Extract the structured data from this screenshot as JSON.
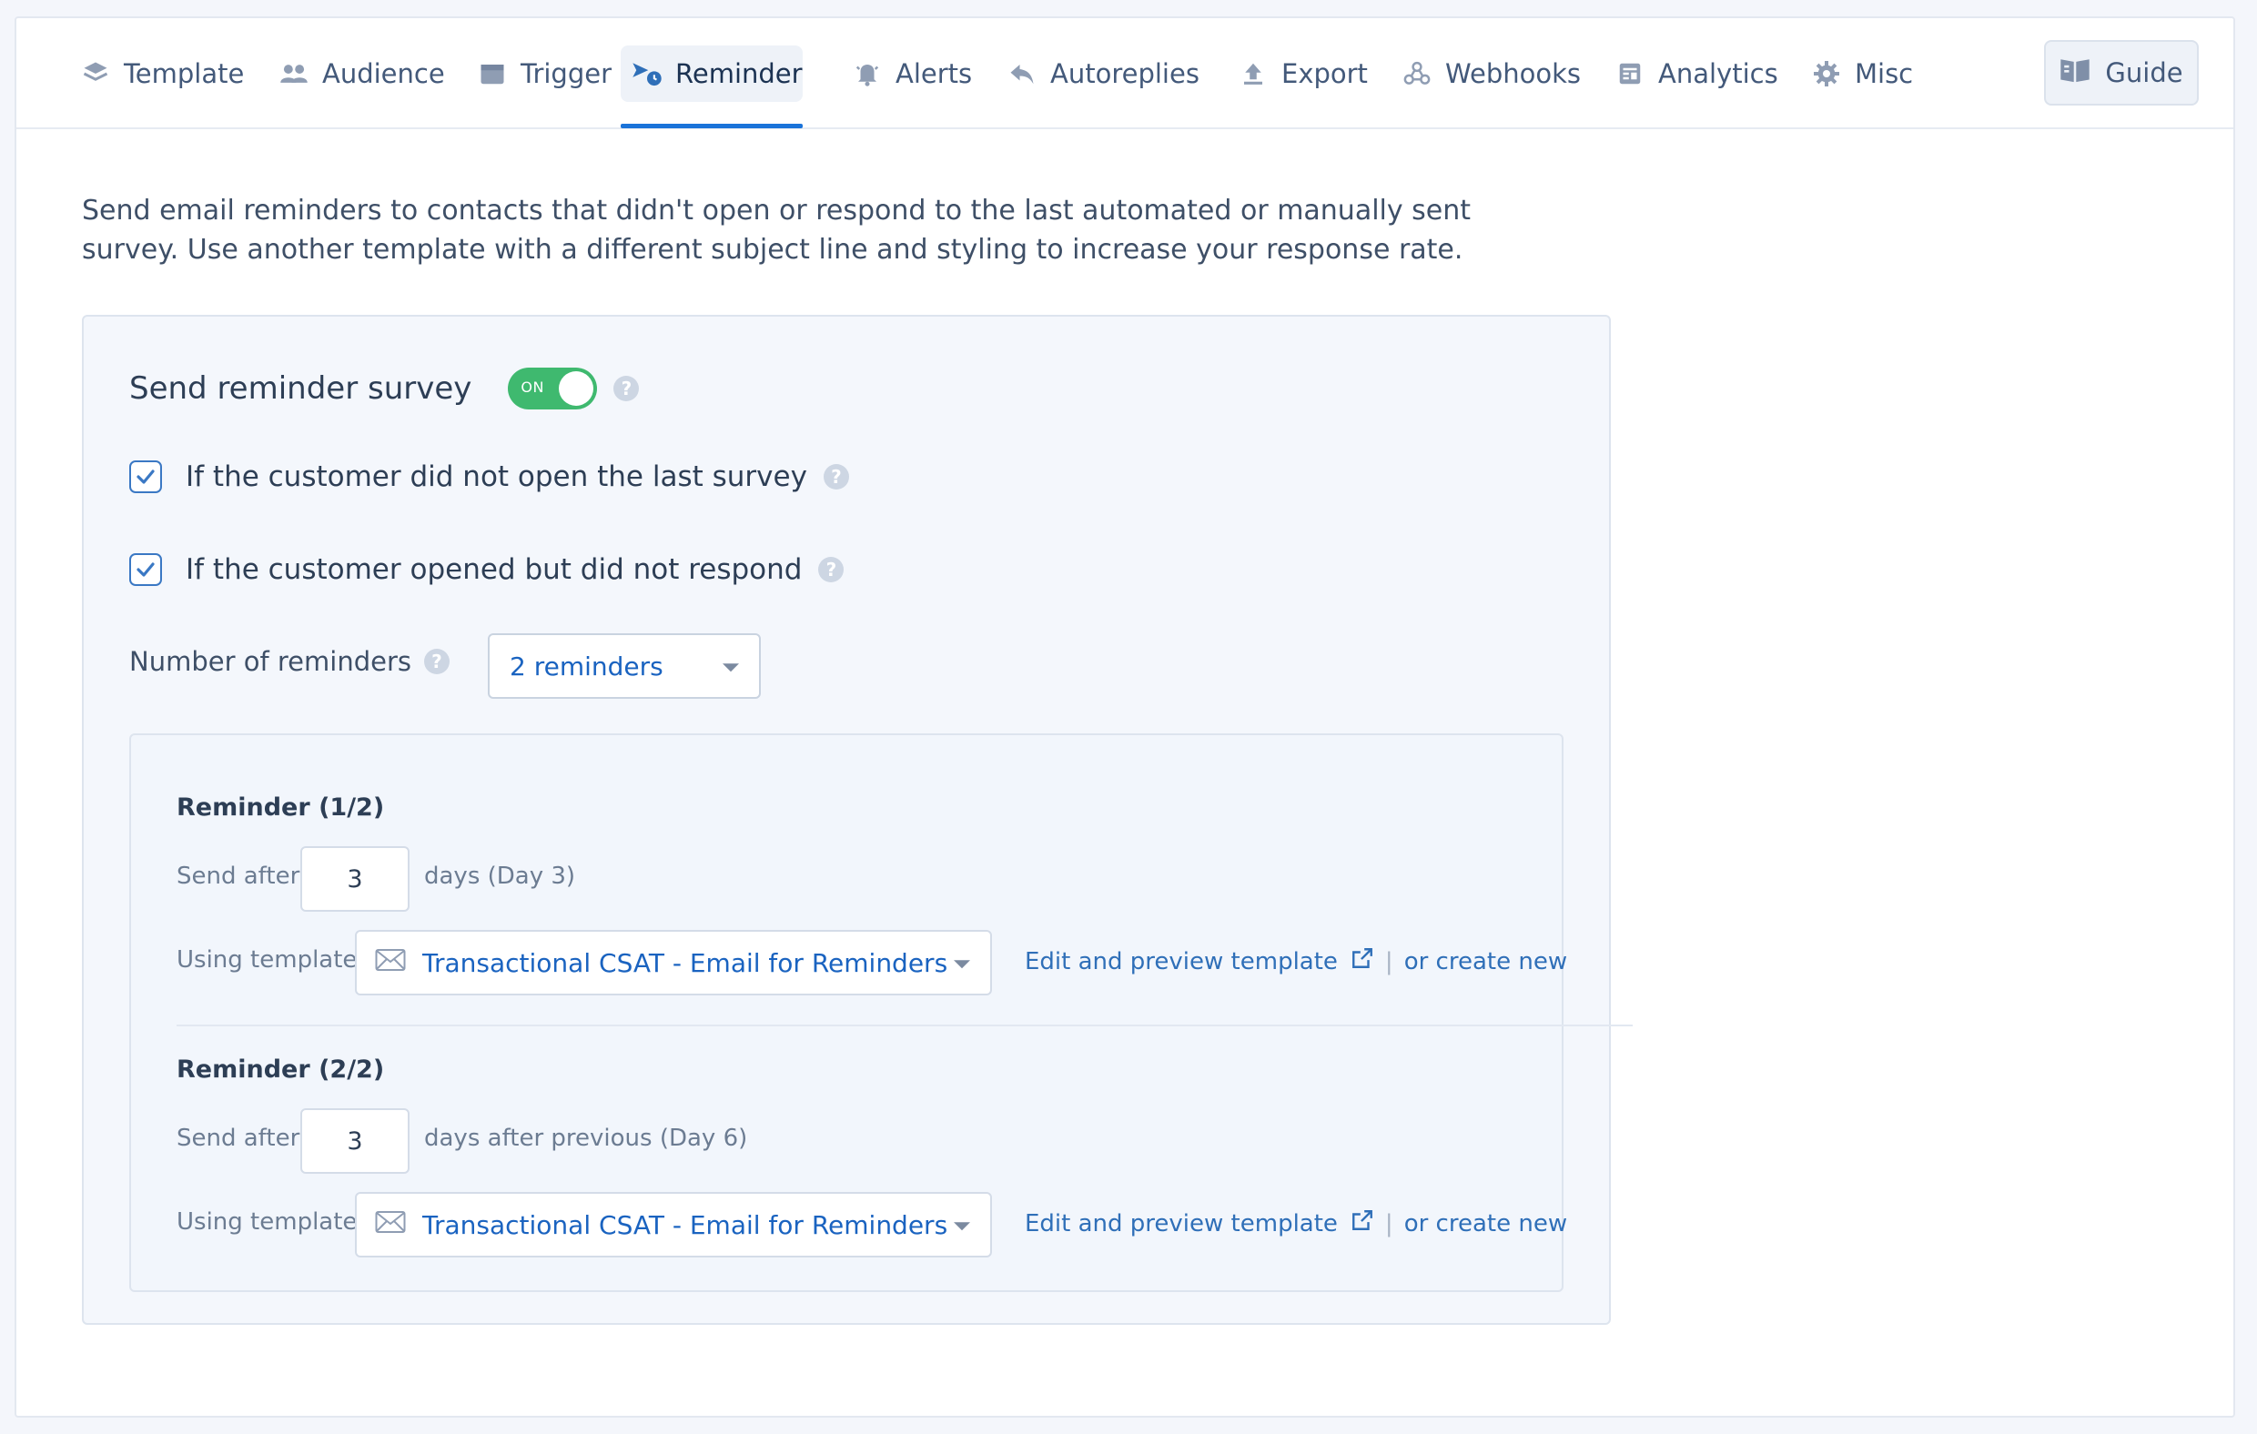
{
  "tabs": [
    {
      "label": "Template",
      "icon": "layers-icon"
    },
    {
      "label": "Audience",
      "icon": "users-icon"
    },
    {
      "label": "Trigger",
      "icon": "calendar-icon"
    },
    {
      "label": "Reminder",
      "icon": "reminder-icon",
      "active": true
    },
    {
      "label": "Alerts",
      "icon": "bell-icon"
    },
    {
      "label": "Autoreplies",
      "icon": "reply-icon"
    },
    {
      "label": "Export",
      "icon": "upload-icon"
    },
    {
      "label": "Webhooks",
      "icon": "webhook-icon"
    },
    {
      "label": "Analytics",
      "icon": "analytics-icon"
    },
    {
      "label": "Misc",
      "icon": "gear-icon"
    }
  ],
  "guide_label": "Guide",
  "intro": "Send email reminders to contacts that didn't open or respond to the last automated or manually sent survey. Use another template with a different subject line and styling to increase your response rate.",
  "reminder_settings": {
    "title": "Send reminder survey",
    "toggle_label": "ON",
    "option_not_opened": "If the customer did not open the last survey",
    "option_opened_no_response": "If the customer opened but did not respond",
    "number_label": "Number of reminders",
    "number_value": "2 reminders"
  },
  "reminders": [
    {
      "title": "Reminder (1/2)",
      "send_after_label": "Send after",
      "days": "3",
      "suffix": "days (Day 3)",
      "template_label": "Using template",
      "template_value": "Transactional CSAT - Email for Reminders",
      "edit_link": "Edit and preview template",
      "create_link": "or create new"
    },
    {
      "title": "Reminder (2/2)",
      "send_after_label": "Send after",
      "days": "3",
      "suffix": "days after previous (Day 6)",
      "template_label": "Using template",
      "template_value": "Transactional CSAT - Email for Reminders",
      "edit_link": "Edit and preview template",
      "create_link": "or create new"
    }
  ],
  "colors": {
    "accent": "#1a73d9",
    "toggle_on": "#3fb96f",
    "link": "#2f6fb8"
  }
}
